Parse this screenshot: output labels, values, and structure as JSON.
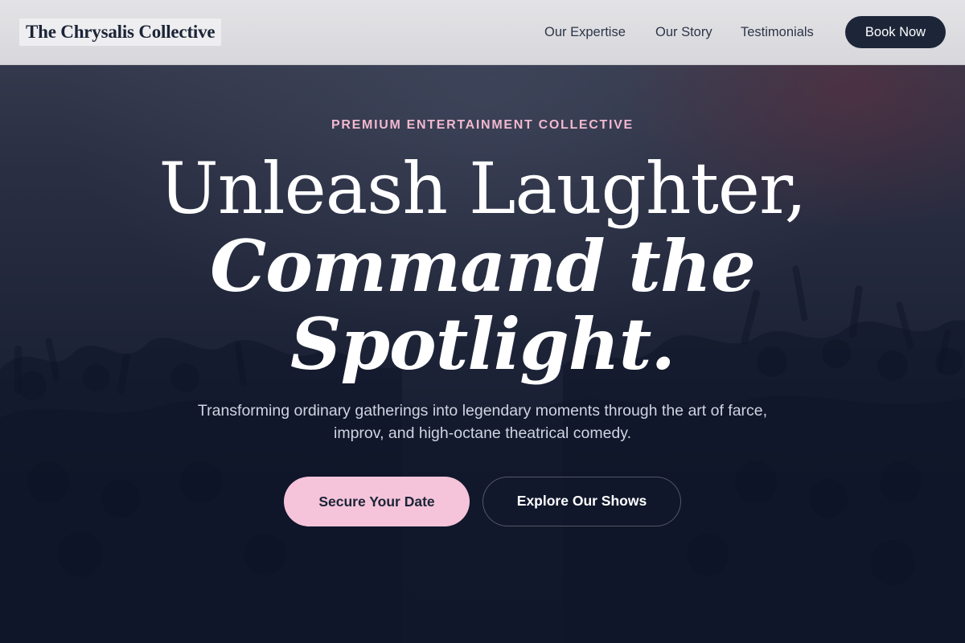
{
  "brand": {
    "name": "The Chrysalis Collective"
  },
  "nav": {
    "links": [
      {
        "label": "Our Expertise"
      },
      {
        "label": "Our Story"
      },
      {
        "label": "Testimonials"
      }
    ],
    "cta_label": "Book Now"
  },
  "hero": {
    "eyebrow": "PREMIUM ENTERTAINMENT COLLECTIVE",
    "headline_line1": "Unleash Laughter,",
    "headline_line2": "Command the",
    "headline_line3": "Spotlight.",
    "subtitle": "Transforming ordinary gatherings into legendary moments through the art of farce, improv, and high-octane theatrical comedy.",
    "primary_cta": "Secure Your Date",
    "secondary_cta": "Explore Our Shows"
  },
  "colors": {
    "accent_pink": "#f5c4da",
    "eyebrow_pink": "#f1b8cf",
    "navy": "#1d2639",
    "hero_background": "#141a2f"
  },
  "icons": [
    "crowd-silhouette-background"
  ]
}
